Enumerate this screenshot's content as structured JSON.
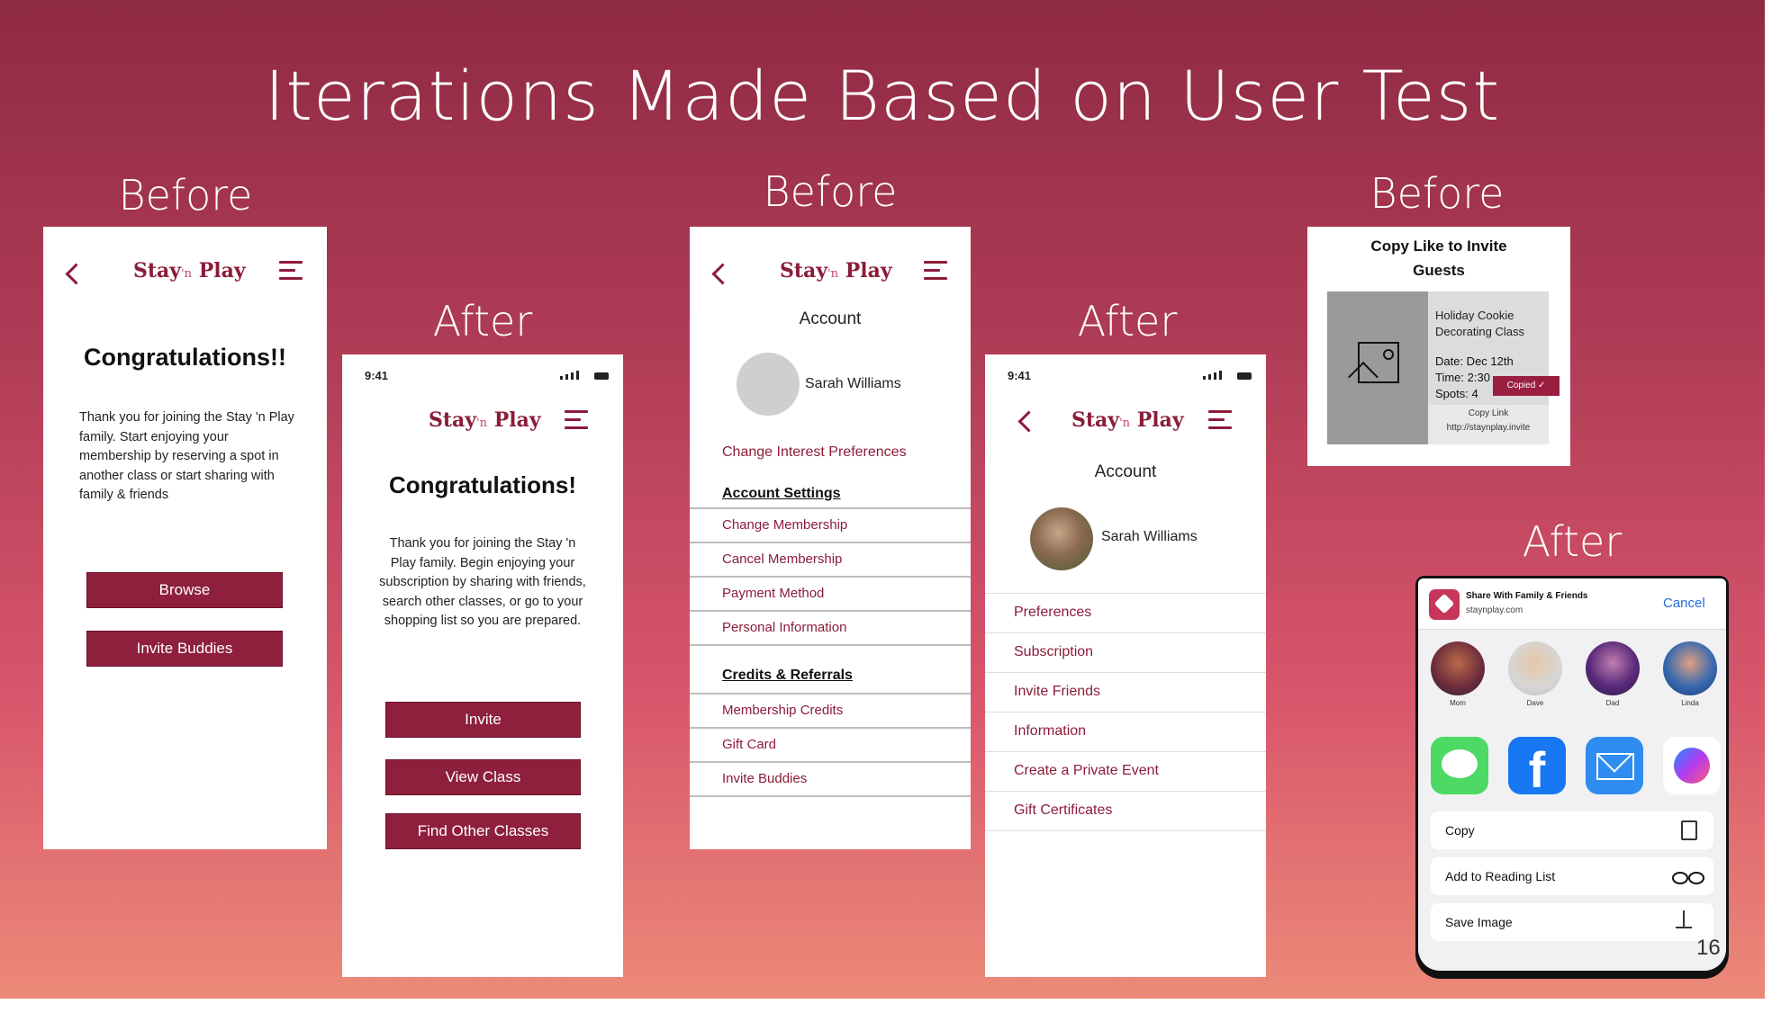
{
  "slide": {
    "title": "Iterations Made Based on User Test",
    "labels": {
      "before": "Before",
      "after": "After"
    },
    "page_number": "16"
  },
  "brand": {
    "stay": "Stay",
    "n": "'n",
    "play": "Play"
  },
  "status_time": "9:41",
  "screen1": {
    "heading": "Congratulations!!",
    "body": "Thank you for joining the Stay 'n Play family. Start enjoying your membership by reserving a spot in another class or start sharing with family & friends",
    "buttons": [
      "Browse",
      "Invite Buddies"
    ]
  },
  "screen2": {
    "heading": "Congratulations!",
    "body": "Thank you for joining the Stay 'n Play family. Begin enjoying your subscription by sharing with friends, search other classes, or go to your shopping list so you are prepared.",
    "buttons": [
      "Invite",
      "View Class",
      "Find Other Classes"
    ]
  },
  "screen3": {
    "heading": "Account",
    "user_name": "Sarah Williams",
    "link": "Change Interest Preferences",
    "section1_title": "Account Settings",
    "section1_items": [
      "Change Membership",
      "Cancel Membership",
      "Payment Method",
      "Personal Information"
    ],
    "section2_title": "Credits & Referrals",
    "section2_items": [
      "Membership Credits",
      "Gift Card",
      "Invite Buddies"
    ]
  },
  "screen4": {
    "heading": "Account",
    "user_name": "Sarah Williams",
    "items": [
      "Preferences",
      "Subscription",
      "Invite Friends",
      "Information",
      "Create a Private Event",
      "Gift Certificates"
    ]
  },
  "screen5": {
    "title": "Copy Like to Invite Guests",
    "class_name": "Holiday Cookie Decorating Class",
    "date": "Date: Dec 12th",
    "time": "Time: 2:30",
    "spots": "Spots: 4",
    "copied_badge": "Copied ✓",
    "copy_link_label": "Copy Link",
    "url": "http://staynplay.invite"
  },
  "screen6": {
    "share_title": "Share With Family & Friends",
    "share_domain": "staynplay.com",
    "cancel": "Cancel",
    "contacts": [
      "Mom",
      "Dave",
      "Dad",
      "Linda"
    ],
    "actions": [
      "Copy",
      "Add to Reading List",
      "Save Image"
    ]
  },
  "colors": {
    "accent": "#8b1c3a",
    "link_blue": "#1f6fd6"
  }
}
